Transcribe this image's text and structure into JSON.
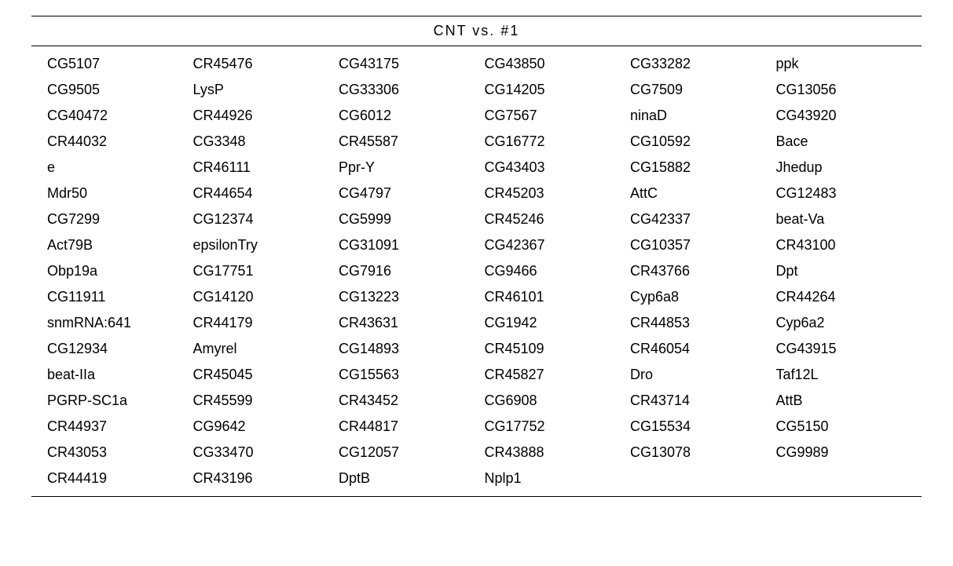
{
  "table": {
    "title": "CNT   vs. #1",
    "rows": [
      [
        "CG5107",
        "CR45476",
        "CG43175",
        "CG43850",
        "CG33282",
        "ppk"
      ],
      [
        "CG9505",
        "LysP",
        "CG33306",
        "CG14205",
        "CG7509",
        "CG13056"
      ],
      [
        "CG40472",
        "CR44926",
        "CG6012",
        "CG7567",
        "ninaD",
        "CG43920"
      ],
      [
        "CR44032",
        "CG3348",
        "CR45587",
        "CG16772",
        "CG10592",
        "Bace"
      ],
      [
        "e",
        "CR46111",
        "Ppr-Y",
        "CG43403",
        "CG15882",
        "Jhedup"
      ],
      [
        "Mdr50",
        "CR44654",
        "CG4797",
        "CR45203",
        "AttC",
        "CG12483"
      ],
      [
        "CG7299",
        "CG12374",
        "CG5999",
        "CR45246",
        "CG42337",
        "beat-Va"
      ],
      [
        "Act79B",
        "epsilonTry",
        "CG31091",
        "CG42367",
        "CG10357",
        "CR43100"
      ],
      [
        "Obp19a",
        "CG17751",
        "CG7916",
        "CG9466",
        "CR43766",
        "Dpt"
      ],
      [
        "CG11911",
        "CG14120",
        "CG13223",
        "CR46101",
        "Cyp6a8",
        "CR44264"
      ],
      [
        "snmRNA:641",
        "CR44179",
        "CR43631",
        "CG1942",
        "CR44853",
        "Cyp6a2"
      ],
      [
        "CG12934",
        "Amyrel",
        "CG14893",
        "CR45109",
        "CR46054",
        "CG43915"
      ],
      [
        "beat-IIa",
        "CR45045",
        "CG15563",
        "CR45827",
        "Dro",
        "Taf12L"
      ],
      [
        "PGRP-SC1a",
        "CR45599",
        "CR43452",
        "CG6908",
        "CR43714",
        "AttB"
      ],
      [
        "CR44937",
        "CG9642",
        "CR44817",
        "CG17752",
        "CG15534",
        "CG5150"
      ],
      [
        "CR43053",
        "CG33470",
        "CG12057",
        "CR43888",
        "CG13078",
        "CG9989"
      ],
      [
        "CR44419",
        "CR43196",
        "DptB",
        "Nplp1",
        "",
        ""
      ]
    ]
  }
}
